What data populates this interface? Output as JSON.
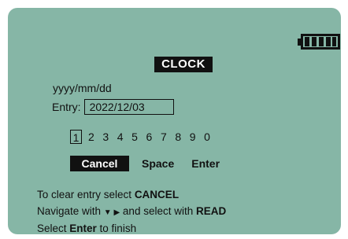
{
  "screen": {
    "title": "CLOCK",
    "format_label": "yyyy/mm/dd",
    "entry_label": "Entry:",
    "entry_value": "2022/12/03"
  },
  "digits": [
    "1",
    "2",
    "3",
    "4",
    "5",
    "6",
    "7",
    "8",
    "9",
    "0"
  ],
  "actions": {
    "cancel": "Cancel",
    "space": "Space",
    "enter": "Enter"
  },
  "help": {
    "line1_prefix": "To clear entry select ",
    "line1_bold": "CANCEL",
    "line2_prefix": "Navigate with ",
    "line2_arrows": "▼ ▶",
    "line2_mid": " and select with ",
    "line2_bold": "READ",
    "line3_prefix": "Select ",
    "line3_bold": "Enter",
    "line3_suffix": " to finish"
  },
  "colors": {
    "screen_bg": "#86b6a6",
    "ink": "#111111"
  },
  "icons": {
    "battery": "battery-full-icon"
  }
}
